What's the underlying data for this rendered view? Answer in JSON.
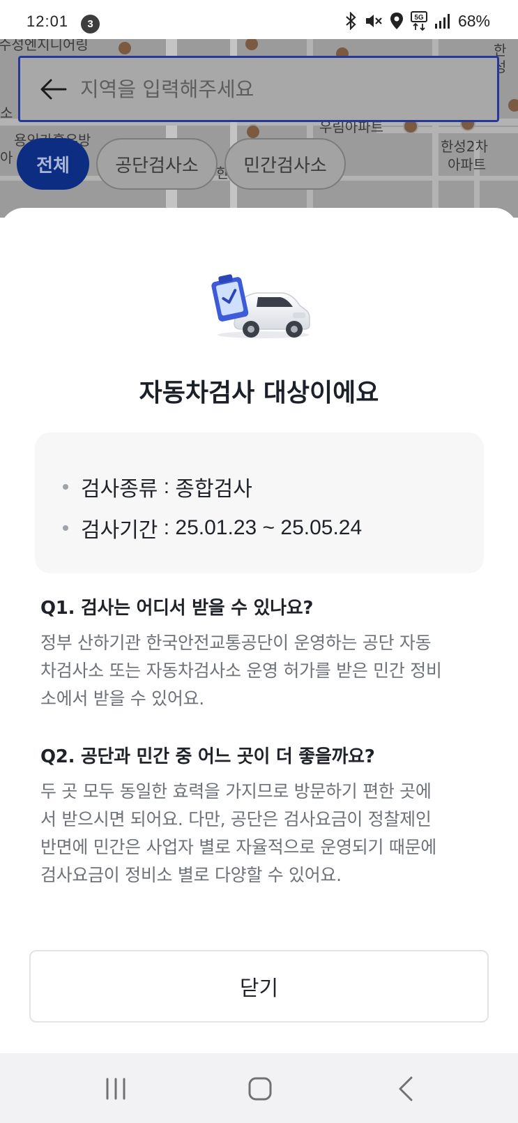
{
  "status_bar": {
    "time": "12:01",
    "notification_count": "3",
    "battery": "68%",
    "icons": [
      "bluetooth-icon",
      "mute-icon",
      "location-icon",
      "5g-icon",
      "signal-icon"
    ]
  },
  "map": {
    "labels": [
      "수성엔지니어링",
      "한성",
      "우림아파트",
      "용인가흥우방",
      "한성2차",
      "아파트",
      "소",
      "아",
      "한"
    ],
    "search": {
      "placeholder": "지역을 입력해주세요"
    },
    "filters": [
      {
        "label": "전체",
        "active": true
      },
      {
        "label": "공단검사소",
        "active": false
      },
      {
        "label": "민간검사소",
        "active": false
      }
    ]
  },
  "sheet": {
    "title": "자동차검사 대상이에요",
    "info": [
      {
        "label": "검사종류",
        "value": "종합검사"
      },
      {
        "label": "검사기간",
        "value": "25.01.23 ~ 25.05.24"
      }
    ],
    "faq": [
      {
        "question": "Q1. 검사는 어디서 받을 수 있나요?",
        "answer_lines": [
          "정부 산하기관 한국안전교통공단이 운영하는 공단 자동",
          "차검사소 또는 자동차검사소 운영 허가를 받은 민간 정비",
          "소에서 받을 수 있어요."
        ]
      },
      {
        "question": "Q2. 공단과 민간 중 어느 곳이 더 좋을까요?",
        "answer_lines": [
          "두 곳 모두 동일한 효력을 가지므로 방문하기 편한 곳에",
          "서 받으시면 되어요. 다만, 공단은 검사요금이 정찰제인",
          "반면에 민간은 사업자 별로 자율적으로 운영되기 때문에",
          "검사요금이 정비소 별로 다양할 수 있어요."
        ]
      }
    ],
    "close_label": "닫기"
  },
  "colors": {
    "accent": "#0c2d81",
    "search_border": "#24389a",
    "info_bg": "#f7f7f8",
    "answer_text": "#6d7178"
  }
}
